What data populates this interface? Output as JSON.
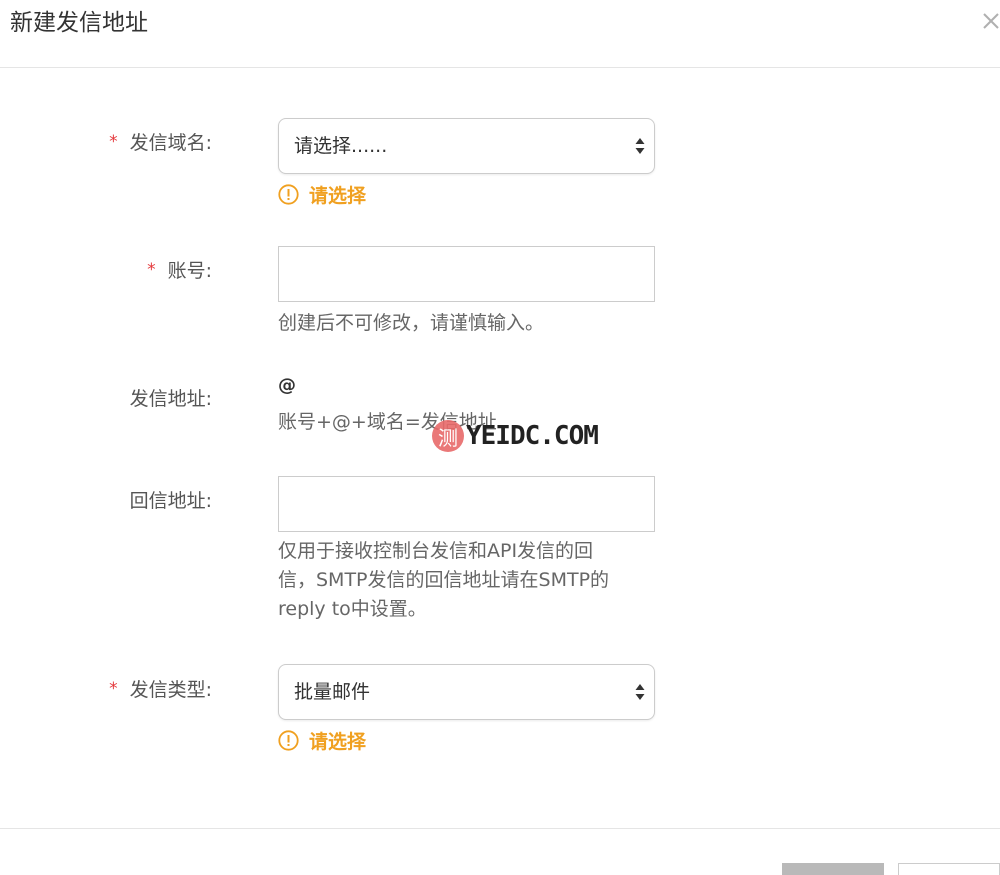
{
  "dialog": {
    "title": "新建发信地址"
  },
  "form": {
    "domain": {
      "required_mark": "*",
      "label": "发信域名:",
      "value": "请选择......",
      "warning": "请选择"
    },
    "account": {
      "required_mark": "*",
      "label": "账号:",
      "value": "",
      "hint": "创建后不可修改，请谨慎输入。"
    },
    "sender_address": {
      "label": "发信地址:",
      "value": "@",
      "hint": "账号+@+域名=发信地址"
    },
    "reply_address": {
      "label": "回信地址:",
      "value": "",
      "hint_lines": [
        "仅用于接收控制台发信和API发信的回",
        "信，SMTP发信的回信地址请在SMTP的",
        "reply to中设置。"
      ]
    },
    "send_type": {
      "required_mark": "*",
      "label": "发信类型:",
      "value": "批量邮件",
      "warning": "请选择"
    }
  },
  "watermark": {
    "badge": "测",
    "text": "YEIDC.COM"
  },
  "colors": {
    "required": "#e4393c",
    "warning": "#f0a020",
    "border": "#cccccc",
    "primary_button": "#b9b9b9"
  },
  "icons": {
    "close": "close-icon",
    "warning": "warning-circle-icon",
    "select_arrows": "sort-arrows-icon"
  }
}
